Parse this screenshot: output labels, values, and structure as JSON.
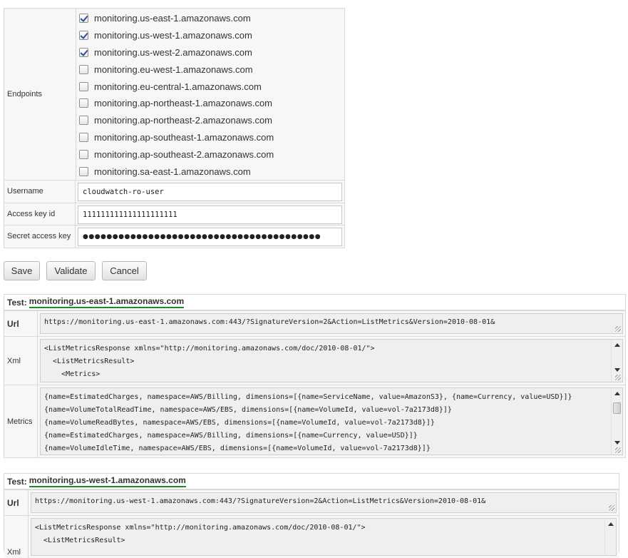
{
  "form": {
    "endpoints_label": "Endpoints",
    "endpoints": [
      {
        "host": "monitoring.us-east-1.amazonaws.com",
        "checked": true
      },
      {
        "host": "monitoring.us-west-1.amazonaws.com",
        "checked": true
      },
      {
        "host": "monitoring.us-west-2.amazonaws.com",
        "checked": true
      },
      {
        "host": "monitoring.eu-west-1.amazonaws.com",
        "checked": false
      },
      {
        "host": "monitoring.eu-central-1.amazonaws.com",
        "checked": false
      },
      {
        "host": "monitoring.ap-northeast-1.amazonaws.com",
        "checked": false
      },
      {
        "host": "monitoring.ap-northeast-2.amazonaws.com",
        "checked": false
      },
      {
        "host": "monitoring.ap-southeast-1.amazonaws.com",
        "checked": false
      },
      {
        "host": "monitoring.ap-southeast-2.amazonaws.com",
        "checked": false
      },
      {
        "host": "monitoring.sa-east-1.amazonaws.com",
        "checked": false
      }
    ],
    "username_label": "Username",
    "username_value": "cloudwatch-ro-user",
    "access_key_label": "Access key id",
    "access_key_value": "111111111111111111111",
    "secret_label": "Secret access key",
    "secret_value": "●●●●●●●●●●●●●●●●●●●●●●●●●●●●●●●●●●●●●●●●"
  },
  "buttons": {
    "save": "Save",
    "validate": "Validate",
    "cancel": "Cancel"
  },
  "tests": [
    {
      "prefix": "Test:",
      "host": "monitoring.us-east-1.amazonaws.com",
      "url_label": "Url",
      "url": "https://monitoring.us-east-1.amazonaws.com:443/?SignatureVersion=2&Action=ListMetrics&Version=2010-08-01&",
      "xml_label": "Xml",
      "xml_lines": [
        "<ListMetricsResponse xmlns=\"http://monitoring.amazonaws.com/doc/2010-08-01/\">",
        "  <ListMetricsResult>",
        "    <Metrics>"
      ],
      "metrics_label": "Metrics",
      "metrics_lines": [
        "{name=EstimatedCharges, namespace=AWS/Billing, dimensions=[{name=ServiceName, value=AmazonS3}, {name=Currency, value=USD}]}",
        "{name=VolumeTotalReadTime, namespace=AWS/EBS, dimensions=[{name=VolumeId, value=vol-7a2173d8}]}",
        "{name=VolumeReadBytes, namespace=AWS/EBS, dimensions=[{name=VolumeId, value=vol-7a2173d8}]}",
        "{name=EstimatedCharges, namespace=AWS/Billing, dimensions=[{name=Currency, value=USD}]}",
        "{name=VolumeIdleTime, namespace=AWS/EBS, dimensions=[{name=VolumeId, value=vol-7a2173d8}]}"
      ]
    },
    {
      "prefix": "Test:",
      "host": "monitoring.us-west-1.amazonaws.com",
      "url_label": "Url",
      "url": "https://monitoring.us-west-1.amazonaws.com:443/?SignatureVersion=2&Action=ListMetrics&Version=2010-08-01&",
      "xml_label": "Xml",
      "xml_lines": [
        "<ListMetricsResponse xmlns=\"http://monitoring.amazonaws.com/doc/2010-08-01/\">",
        "  <ListMetricsResult>"
      ]
    }
  ]
}
